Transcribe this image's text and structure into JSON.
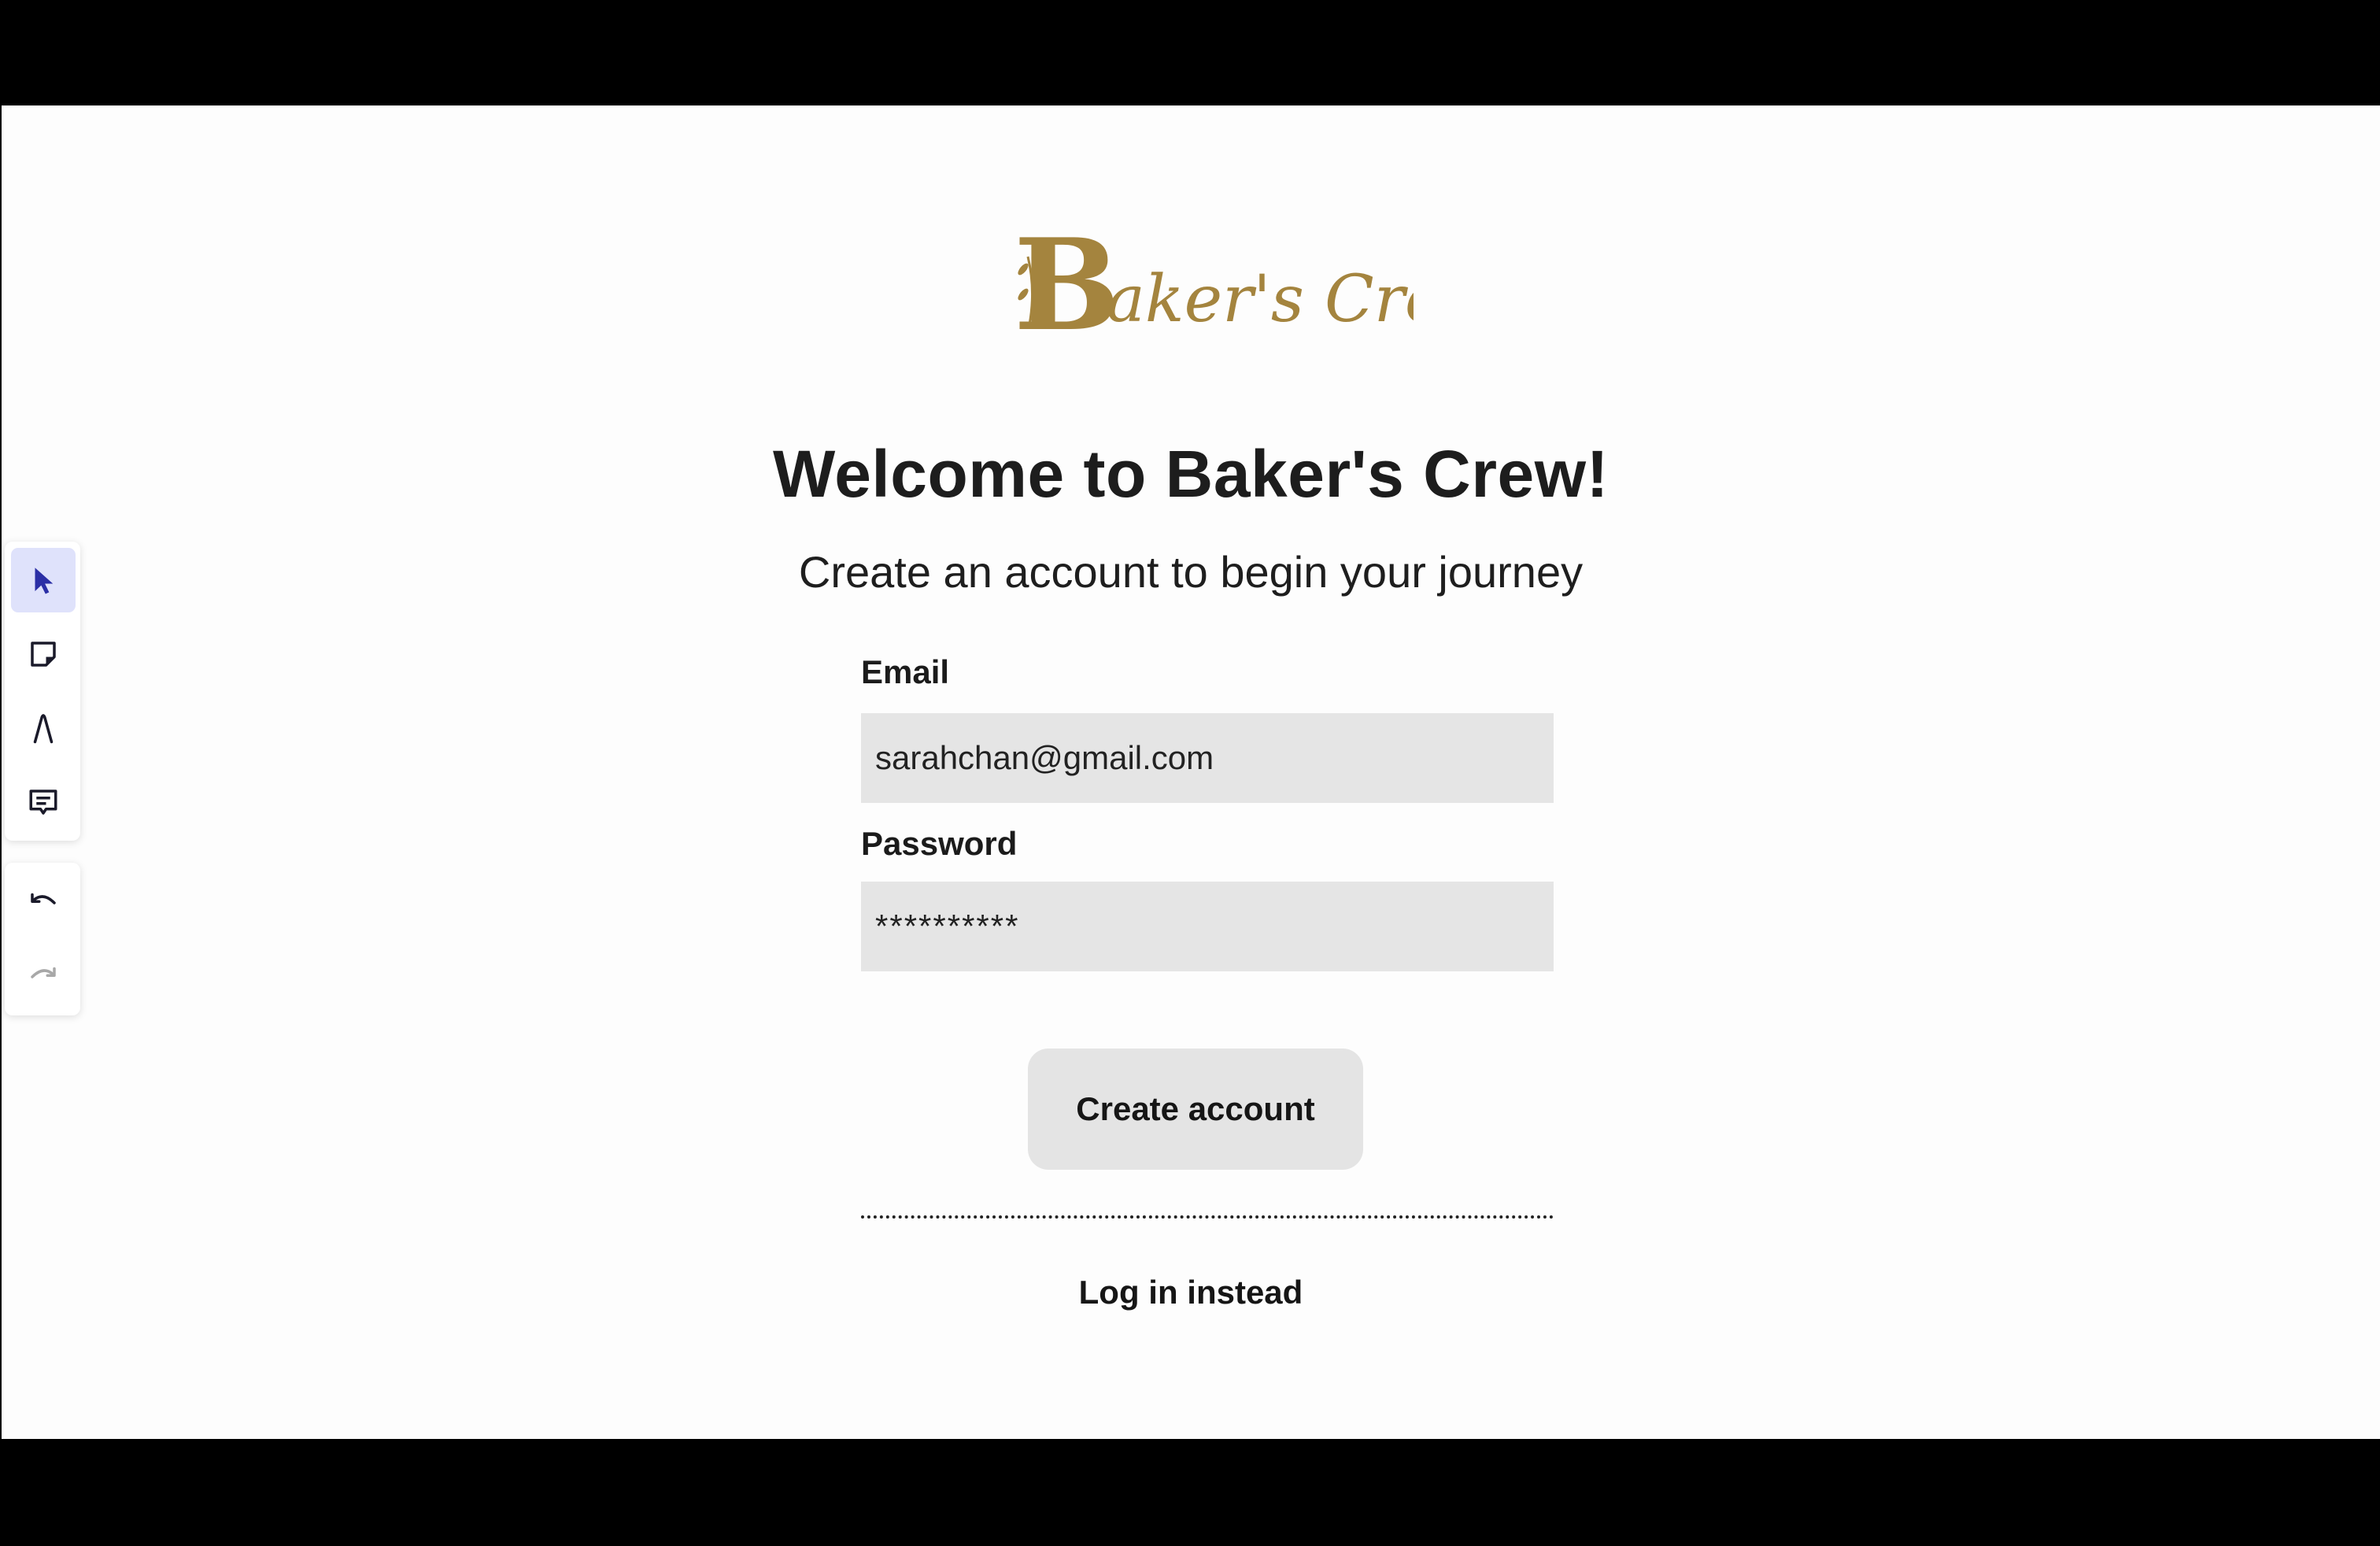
{
  "brand": {
    "logo_text": "aker's Crew",
    "logo_initial": "B",
    "logo_color": "#a4843e"
  },
  "toolbar": {
    "tools": [
      {
        "name": "select",
        "icon": "cursor-arrow-icon",
        "active": true
      },
      {
        "name": "sticky-note",
        "icon": "sticky-note-icon",
        "active": false
      },
      {
        "name": "pen",
        "icon": "pen-icon",
        "active": false
      },
      {
        "name": "comment",
        "icon": "comment-icon",
        "active": false
      }
    ],
    "history": [
      {
        "name": "undo",
        "icon": "undo-icon",
        "enabled": true
      },
      {
        "name": "redo",
        "icon": "redo-icon",
        "enabled": false
      }
    ],
    "active_color": "#2b2fa6",
    "active_bg": "#dfe2fb"
  },
  "form": {
    "title": "Welcome to Baker's Crew!",
    "subtitle": "Create an account to begin your journey",
    "email_label": "Email",
    "email_value": "sarahchan@gmail.com",
    "password_label": "Password",
    "password_value": "**********",
    "submit_label": "Create account",
    "alt_link": "Log in instead"
  }
}
